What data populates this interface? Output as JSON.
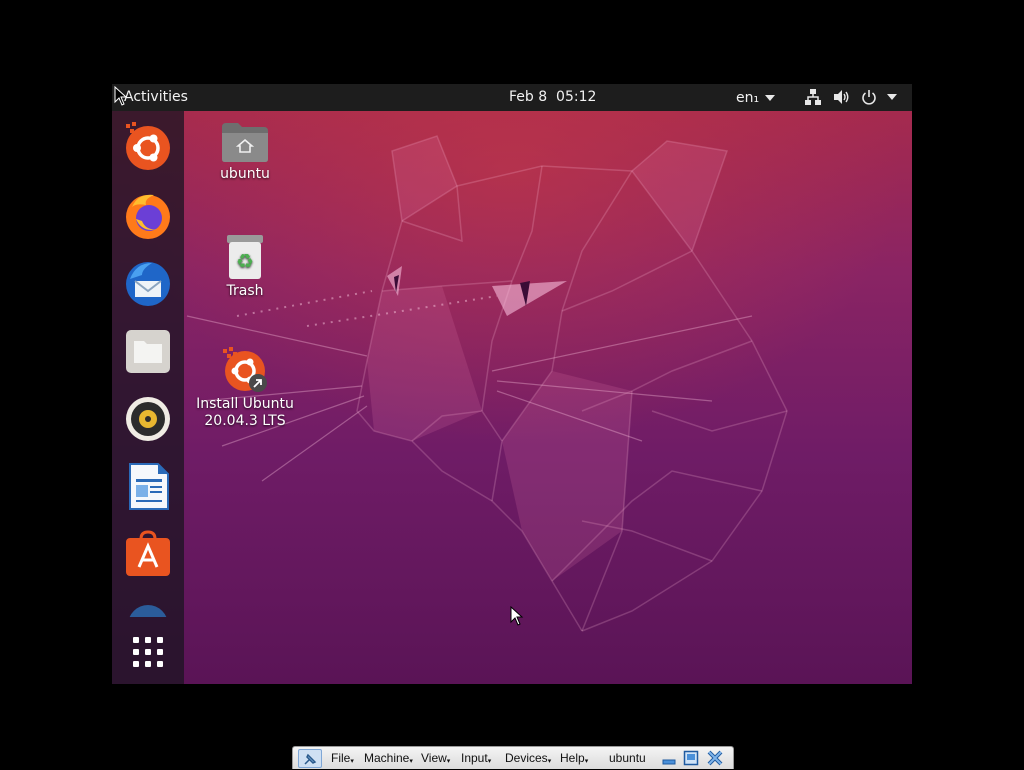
{
  "topbar": {
    "activities_label": "Activities",
    "clock": "Feb 8  05:12",
    "language": "en₁"
  },
  "tray_icons": [
    "network-icon",
    "volume-icon",
    "power-icon",
    "chevron-down-icon"
  ],
  "dock": {
    "items": [
      {
        "name": "ubuntu-installer",
        "icon": "ubuntu-logo-icon"
      },
      {
        "name": "firefox",
        "icon": "firefox-icon"
      },
      {
        "name": "thunderbird",
        "icon": "thunderbird-icon"
      },
      {
        "name": "files",
        "icon": "files-icon"
      },
      {
        "name": "rhythmbox",
        "icon": "speaker-icon"
      },
      {
        "name": "libreoffice-writer",
        "icon": "writer-icon"
      },
      {
        "name": "ubuntu-software",
        "icon": "software-store-icon"
      },
      {
        "name": "help",
        "icon": "help-icon"
      }
    ],
    "show_apps_icon": "app-grid-icon"
  },
  "desktop_icons": {
    "home_label": "ubuntu",
    "trash_label": "Trash",
    "install_label_line1": "Install Ubuntu",
    "install_label_line2": "20.04.3 LTS"
  },
  "vbox_bar": {
    "menus": {
      "file": "File",
      "machine": "Machine",
      "view": "View",
      "input": "Input",
      "devices": "Devices",
      "help": "Help"
    },
    "vm_name": "ubuntu"
  },
  "colors": {
    "ubuntu_orange": "#E95420",
    "topbar": "#1D1D1D",
    "wallpaper_top": "#A52A4E",
    "wallpaper_bottom": "#5A1456"
  }
}
